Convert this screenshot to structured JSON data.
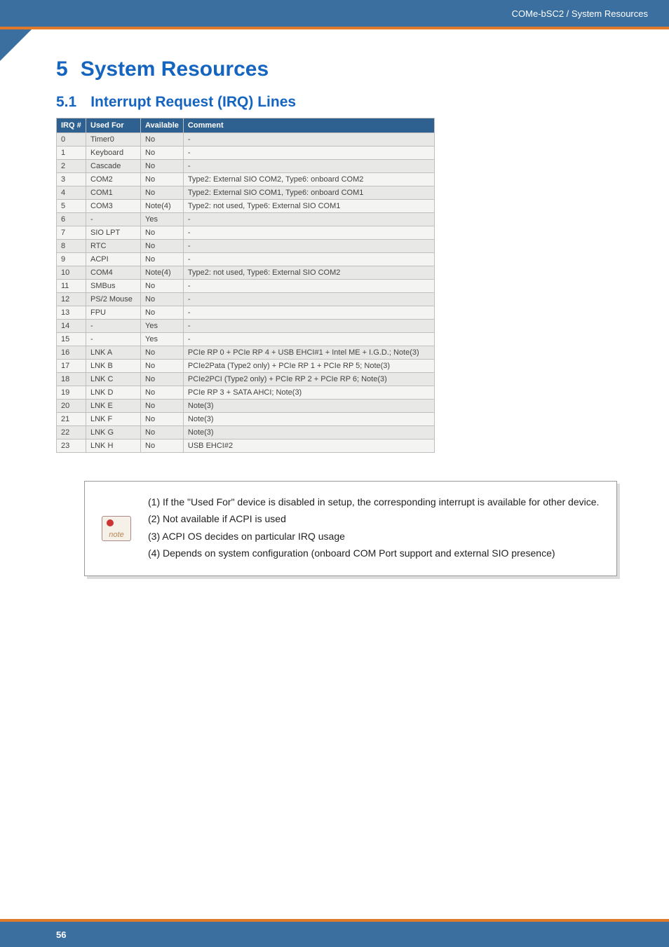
{
  "header": {
    "breadcrumb": "COMe-bSC2 / System Resources"
  },
  "chapter": {
    "number": "5",
    "title": "System Resources"
  },
  "section": {
    "number": "5.1",
    "title": "Interrupt Request (IRQ) Lines"
  },
  "table": {
    "headers": [
      "IRQ #",
      "Used For",
      "Available",
      "Comment"
    ],
    "rows": [
      {
        "irq": "0",
        "used": "Timer0",
        "avail": "No",
        "comment": "-"
      },
      {
        "irq": "1",
        "used": "Keyboard",
        "avail": "No",
        "comment": "-"
      },
      {
        "irq": "2",
        "used": "Cascade",
        "avail": "No",
        "comment": "-"
      },
      {
        "irq": "3",
        "used": "COM2",
        "avail": "No",
        "comment": "Type2: External SIO COM2, Type6: onboard COM2"
      },
      {
        "irq": "4",
        "used": "COM1",
        "avail": "No",
        "comment": "Type2: External SIO COM1, Type6: onboard COM1"
      },
      {
        "irq": "5",
        "used": "COM3",
        "avail": "Note(4)",
        "comment": "Type2: not used, Type6: External SIO COM1"
      },
      {
        "irq": "6",
        "used": "-",
        "avail": "Yes",
        "comment": "-"
      },
      {
        "irq": "7",
        "used": "SIO LPT",
        "avail": "No",
        "comment": "-"
      },
      {
        "irq": "8",
        "used": "RTC",
        "avail": "No",
        "comment": "-"
      },
      {
        "irq": "9",
        "used": "ACPI",
        "avail": "No",
        "comment": "-"
      },
      {
        "irq": "10",
        "used": "COM4",
        "avail": "Note(4)",
        "comment": "Type2: not used, Type6: External SIO COM2"
      },
      {
        "irq": "11",
        "used": "SMBus",
        "avail": "No",
        "comment": "-"
      },
      {
        "irq": "12",
        "used": "PS/2 Mouse",
        "avail": "No",
        "comment": "-"
      },
      {
        "irq": "13",
        "used": "FPU",
        "avail": "No",
        "comment": "-"
      },
      {
        "irq": "14",
        "used": "-",
        "avail": "Yes",
        "comment": "-"
      },
      {
        "irq": "15",
        "used": "-",
        "avail": "Yes",
        "comment": "-"
      },
      {
        "irq": "16",
        "used": "LNK A",
        "avail": "No",
        "comment": "PCIe RP 0 + PCIe RP 4 + USB EHCI#1 + Intel ME + I.G.D.; Note(3)"
      },
      {
        "irq": "17",
        "used": "LNK B",
        "avail": "No",
        "comment": "PCIe2Pata (Type2 only) + PCIe RP 1 + PCIe RP 5; Note(3)"
      },
      {
        "irq": "18",
        "used": "LNK C",
        "avail": "No",
        "comment": "PCIe2PCI (Type2 only) + PCIe RP 2 + PCIe RP 6; Note(3)"
      },
      {
        "irq": "19",
        "used": "LNK D",
        "avail": "No",
        "comment": "PCIe RP 3 + SATA AHCI; Note(3)"
      },
      {
        "irq": "20",
        "used": "LNK E",
        "avail": "No",
        "comment": "Note(3)"
      },
      {
        "irq": "21",
        "used": "LNK F",
        "avail": "No",
        "comment": "Note(3)"
      },
      {
        "irq": "22",
        "used": "LNK G",
        "avail": "No",
        "comment": "Note(3)"
      },
      {
        "irq": "23",
        "used": "LNK H",
        "avail": "No",
        "comment": "USB EHCI#2"
      }
    ]
  },
  "notes": {
    "icon_label": "note",
    "lines": [
      "(1) If the \"Used For\" device is disabled in setup, the corresponding interrupt is available for other device.",
      "(2) Not available if ACPI is used",
      "(3) ACPI OS decides on particular IRQ usage",
      "(4) Depends on system configuration (onboard COM Port support and external SIO presence)"
    ]
  },
  "footer": {
    "page": "56"
  }
}
